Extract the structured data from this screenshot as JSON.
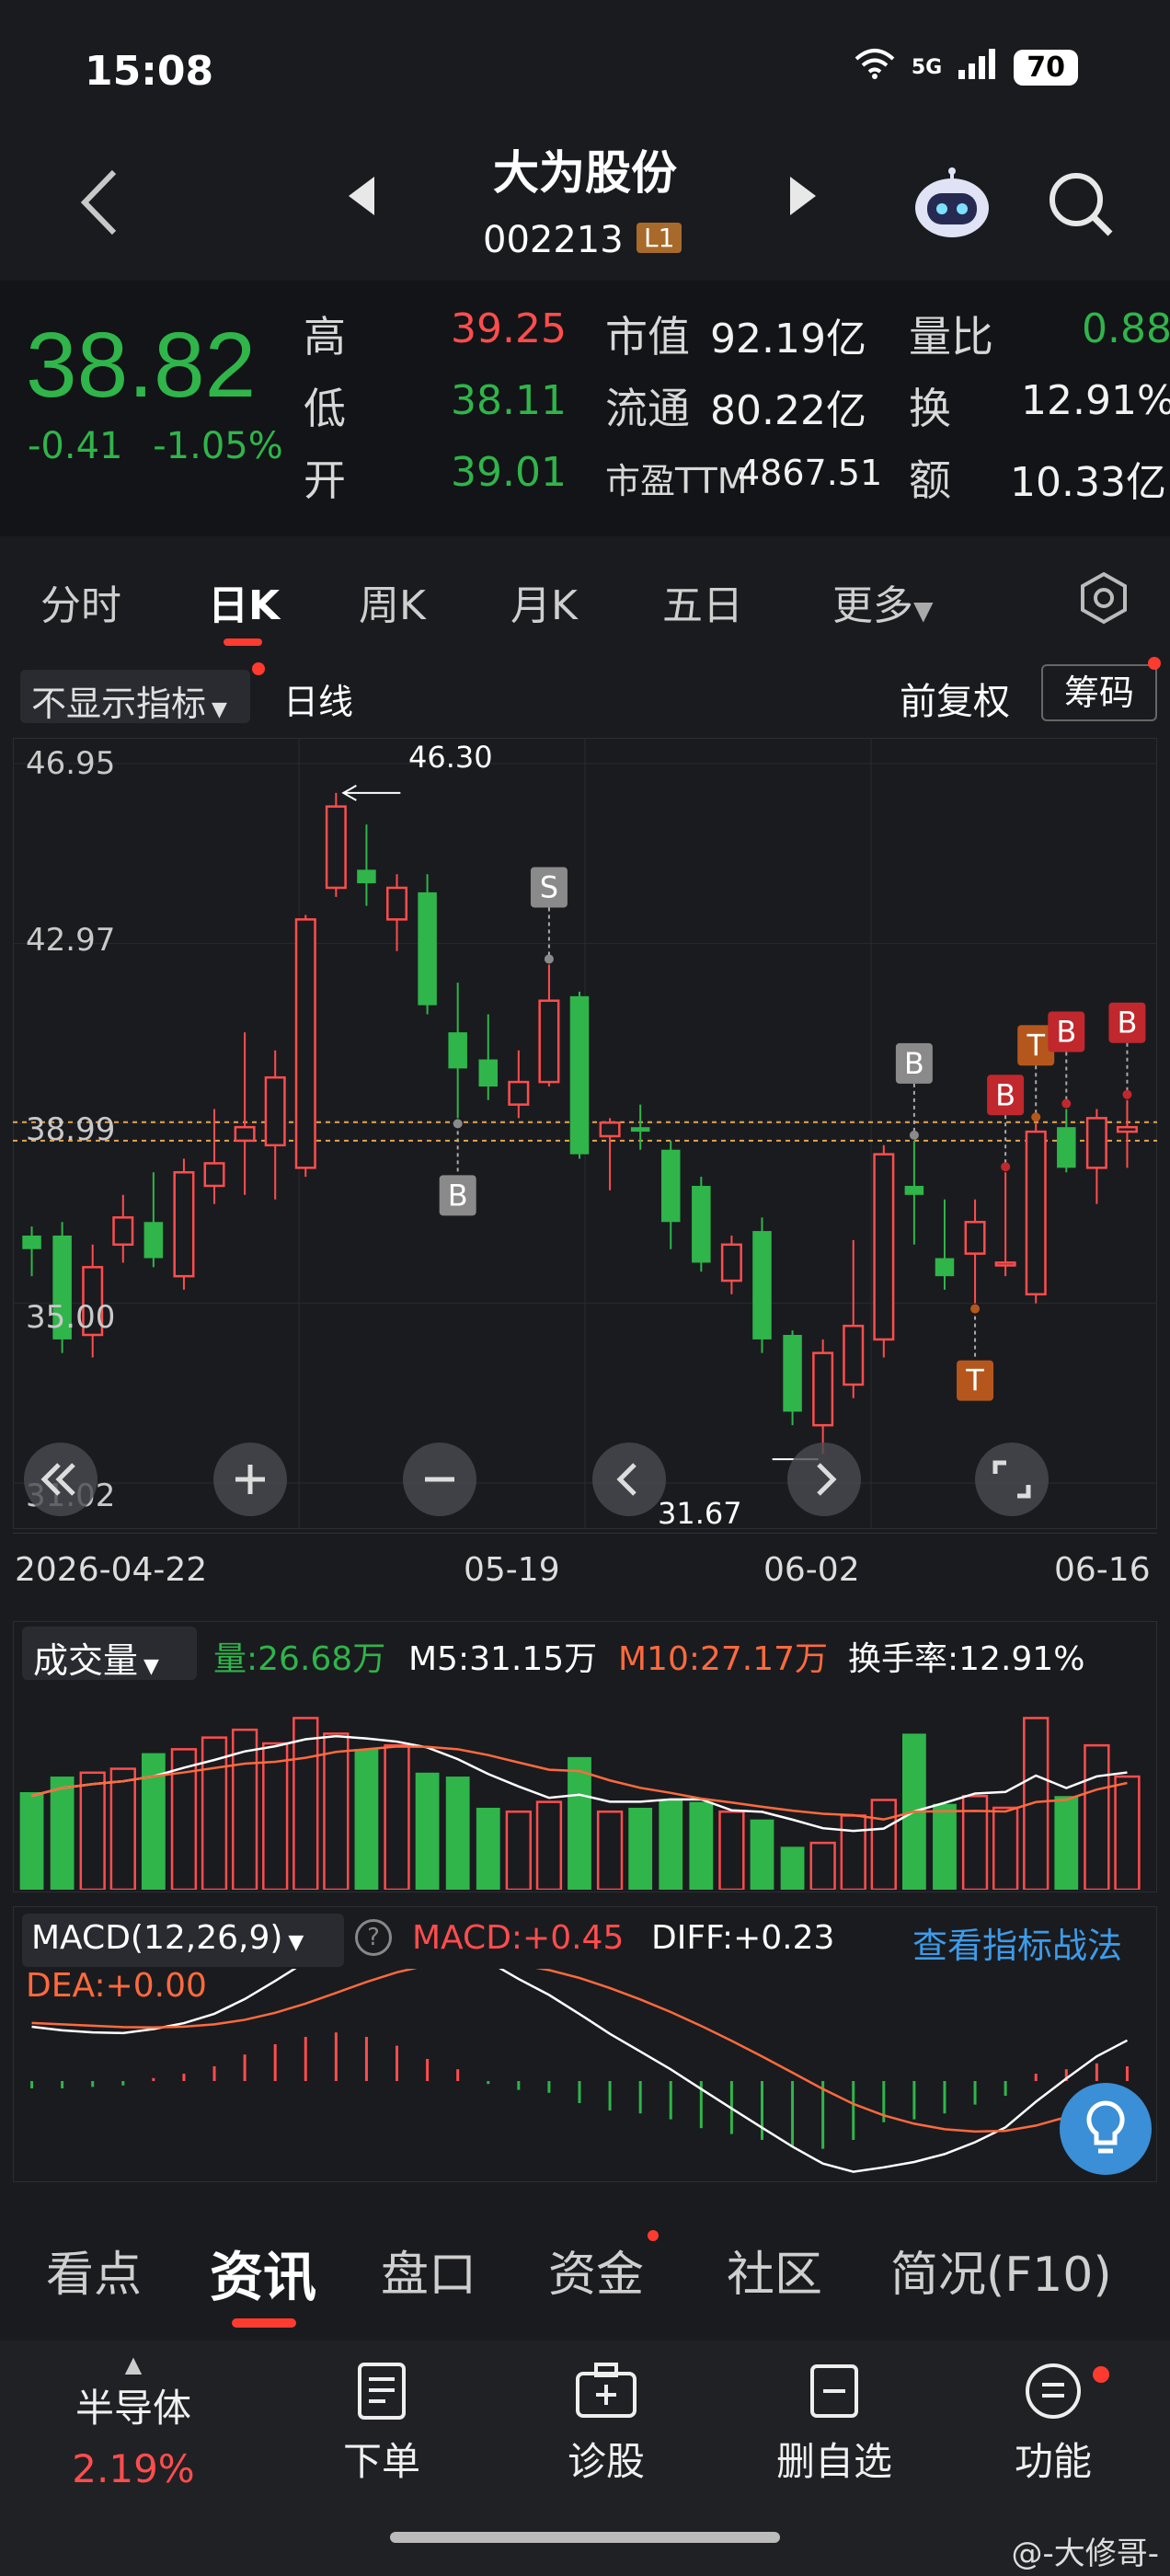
{
  "status": {
    "time": "15:08",
    "network": "5G",
    "battery": "70"
  },
  "header": {
    "stock_name": "大为股份",
    "stock_code": "002213",
    "level": "L1"
  },
  "quote": {
    "price": "38.82",
    "change": "-0.41",
    "change_pct": "-1.05%",
    "high_label": "高",
    "high": "39.25",
    "low_label": "低",
    "low": "38.11",
    "open_label": "开",
    "open": "39.01",
    "mcap_label": "市值",
    "mcap": "92.19亿",
    "float_label": "流通",
    "float": "80.22亿",
    "pe_label": "市盈TTM",
    "pe": "4867.51",
    "vr_label": "量比",
    "vr": "0.88",
    "turnover_label": "换",
    "turnover": "12.91%",
    "amount_label": "额",
    "amount": "10.33亿"
  },
  "chart_tabs": [
    "分时",
    "日K",
    "周K",
    "月K",
    "五日",
    "更多"
  ],
  "chart_toolbar": {
    "indicator": "不显示指标",
    "line_type": "日线",
    "adjust": "前复权",
    "chips": "筹码"
  },
  "chart_data": {
    "type": "candlestick",
    "y_ticks": [
      "46.95",
      "42.97",
      "38.99",
      "35.00",
      "31.02"
    ],
    "x_ticks": [
      "2026-04-22",
      "05-19",
      "06-02",
      "06-16"
    ],
    "max_label": "46.30",
    "min_label": "31.67",
    "candles": [
      {
        "o": 36.5,
        "c": 36.2,
        "h": 36.7,
        "l": 35.6
      },
      {
        "o": 36.5,
        "c": 34.2,
        "h": 36.8,
        "l": 33.9
      },
      {
        "o": 34.3,
        "c": 35.8,
        "h": 36.3,
        "l": 33.8
      },
      {
        "o": 36.3,
        "c": 36.9,
        "h": 37.4,
        "l": 35.9
      },
      {
        "o": 36.8,
        "c": 36.0,
        "h": 37.9,
        "l": 35.8
      },
      {
        "o": 35.6,
        "c": 37.9,
        "h": 38.2,
        "l": 35.3
      },
      {
        "o": 37.6,
        "c": 38.1,
        "h": 39.3,
        "l": 37.2
      },
      {
        "o": 38.6,
        "c": 38.9,
        "h": 41.0,
        "l": 37.4
      },
      {
        "o": 38.5,
        "c": 40.0,
        "h": 40.6,
        "l": 37.3
      },
      {
        "o": 38.0,
        "c": 43.5,
        "h": 43.6,
        "l": 37.8
      },
      {
        "o": 44.2,
        "c": 46.0,
        "h": 46.3,
        "l": 44.0
      },
      {
        "o": 44.6,
        "c": 44.3,
        "h": 45.6,
        "l": 43.8
      },
      {
        "o": 43.5,
        "c": 44.2,
        "h": 44.5,
        "l": 42.8
      },
      {
        "o": 44.1,
        "c": 41.6,
        "h": 44.5,
        "l": 41.4
      },
      {
        "o": 41.0,
        "c": 40.2,
        "h": 42.1,
        "l": 39.1
      },
      {
        "o": 40.4,
        "c": 39.8,
        "h": 41.4,
        "l": 39.5
      },
      {
        "o": 39.4,
        "c": 39.9,
        "h": 40.6,
        "l": 39.1
      },
      {
        "o": 39.9,
        "c": 41.7,
        "h": 42.5,
        "l": 39.8
      },
      {
        "o": 41.8,
        "c": 38.3,
        "h": 41.9,
        "l": 38.2
      },
      {
        "o": 38.7,
        "c": 39.0,
        "h": 39.1,
        "l": 37.5
      },
      {
        "o": 38.9,
        "c": 38.8,
        "h": 39.4,
        "l": 38.4
      },
      {
        "o": 38.4,
        "c": 36.8,
        "h": 38.6,
        "l": 36.2
      },
      {
        "o": 37.6,
        "c": 35.9,
        "h": 37.8,
        "l": 35.7
      },
      {
        "o": 35.5,
        "c": 36.3,
        "h": 36.5,
        "l": 35.2
      },
      {
        "o": 36.6,
        "c": 34.2,
        "h": 36.9,
        "l": 33.9
      },
      {
        "o": 34.3,
        "c": 32.6,
        "h": 34.4,
        "l": 32.3
      },
      {
        "o": 32.3,
        "c": 33.9,
        "h": 34.2,
        "l": 31.67
      },
      {
        "o": 33.2,
        "c": 34.5,
        "h": 36.4,
        "l": 32.9
      },
      {
        "o": 34.2,
        "c": 38.3,
        "h": 38.5,
        "l": 33.8
      },
      {
        "o": 37.6,
        "c": 37.4,
        "h": 38.6,
        "l": 36.3
      },
      {
        "o": 36.0,
        "c": 35.6,
        "h": 37.3,
        "l": 35.3
      },
      {
        "o": 36.1,
        "c": 36.8,
        "h": 37.3,
        "l": 35.0
      },
      {
        "o": 35.9,
        "c": 35.9,
        "h": 37.9,
        "l": 35.6
      },
      {
        "o": 35.2,
        "c": 38.8,
        "h": 39.0,
        "l": 35.0
      },
      {
        "o": 38.9,
        "c": 38.0,
        "h": 39.3,
        "l": 37.9
      },
      {
        "o": 38.0,
        "c": 39.1,
        "h": 39.3,
        "l": 37.2
      },
      {
        "o": 38.8,
        "c": 38.9,
        "h": 39.5,
        "l": 38.0
      }
    ],
    "markers": [
      {
        "label": "S",
        "i": 17,
        "pos": "above",
        "color": "#8a8a8a"
      },
      {
        "label": "B",
        "i": 14,
        "pos": "below",
        "color": "#8a8a8a"
      },
      {
        "label": "B",
        "i": 29,
        "pos": "above",
        "color": "#8a8a8a"
      },
      {
        "label": "B",
        "i": 32,
        "pos": "above",
        "color": "#c0282d"
      },
      {
        "label": "T",
        "i": 33,
        "pos": "above",
        "color": "#b5571c"
      },
      {
        "label": "B",
        "i": 34,
        "pos": "above",
        "color": "#c0282d"
      },
      {
        "label": "B",
        "i": 36,
        "pos": "above",
        "color": "#c0282d"
      },
      {
        "label": "T",
        "i": 31,
        "pos": "below",
        "color": "#b5571c"
      }
    ],
    "volume": [
      0.5,
      0.58,
      0.6,
      0.62,
      0.7,
      0.72,
      0.78,
      0.82,
      0.75,
      0.88,
      0.8,
      0.72,
      0.74,
      0.6,
      0.58,
      0.42,
      0.4,
      0.45,
      0.68,
      0.4,
      0.42,
      0.46,
      0.45,
      0.4,
      0.36,
      0.22,
      0.24,
      0.38,
      0.46,
      0.8,
      0.44,
      0.48,
      0.42,
      0.88,
      0.48,
      0.74,
      0.58
    ],
    "macd_hist": [
      -0.05,
      -0.05,
      -0.04,
      -0.03,
      0.02,
      0.05,
      0.1,
      0.18,
      0.25,
      0.3,
      0.33,
      0.3,
      0.24,
      0.15,
      0.08,
      -0.02,
      -0.06,
      -0.08,
      -0.15,
      -0.2,
      -0.22,
      -0.26,
      -0.32,
      -0.36,
      -0.4,
      -0.44,
      -0.46,
      -0.4,
      -0.28,
      -0.26,
      -0.22,
      -0.16,
      -0.1,
      0.05,
      0.08,
      0.12,
      0.1
    ]
  },
  "volume_panel": {
    "selector": "成交量",
    "vol": "量:26.68万",
    "m5": "M5:31.15万",
    "m10": "M10:27.17万",
    "turnover": "换手率:12.91%"
  },
  "macd_panel": {
    "selector": "MACD(12,26,9)",
    "macd": "MACD:+0.45",
    "diff": "DIFF:+0.23",
    "dea": "DEA:+0.00",
    "link": "查看指标战法"
  },
  "info_tabs": [
    "看点",
    "资讯",
    "盘口",
    "资金",
    "社区",
    "简况(F10)"
  ],
  "bottom_bar": {
    "sector_name": "半导体",
    "sector_pct": "2.19%",
    "order": "下单",
    "diagnose": "诊股",
    "remove_watch": "删自选",
    "functions": "功能"
  },
  "watermark": "@-大修哥-",
  "colors": {
    "up": "#ff4d4d",
    "down": "#2fb54a",
    "bg": "#1a1b1f"
  }
}
